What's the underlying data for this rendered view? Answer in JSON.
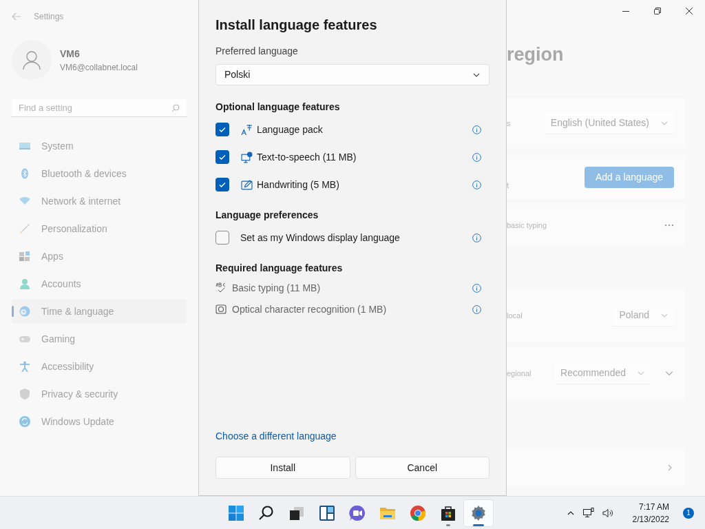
{
  "settings": {
    "title": "Settings",
    "account": {
      "name": "VM6",
      "email": "VM6@collabnet.local"
    },
    "search": {
      "placeholder": "Find a setting"
    },
    "nav": [
      {
        "label": "System",
        "selected": false
      },
      {
        "label": "Bluetooth & devices",
        "selected": false
      },
      {
        "label": "Network & internet",
        "selected": false
      },
      {
        "label": "Personalization",
        "selected": false
      },
      {
        "label": "Apps",
        "selected": false
      },
      {
        "label": "Accounts",
        "selected": false
      },
      {
        "label": "Time & language",
        "selected": true
      },
      {
        "label": "Gaming",
        "selected": false
      },
      {
        "label": "Accessibility",
        "selected": false
      },
      {
        "label": "Privacy & security",
        "selected": false
      },
      {
        "label": "Windows Update",
        "selected": false
      }
    ],
    "page_title": "region",
    "cards": [
      {
        "kind": "dropdown",
        "label": "s",
        "value": "English (United States)"
      },
      {
        "kind": "button",
        "label": "t",
        "button": "Add a language"
      },
      {
        "kind": "more",
        "label": "basic typing"
      },
      {
        "kind": "dropdown",
        "label": "local",
        "value": "Poland"
      },
      {
        "kind": "dropdown_expand",
        "label": "egional",
        "value": "Recommended"
      },
      {
        "kind": "link"
      }
    ]
  },
  "dialog": {
    "title": "Install language features",
    "preferred_label": "Preferred language",
    "preferred_value": "Polski",
    "optional_heading": "Optional language features",
    "optional_features": [
      {
        "label": "Language pack",
        "checked": true
      },
      {
        "label": "Text-to-speech (11 MB)",
        "checked": true
      },
      {
        "label": "Handwriting (5 MB)",
        "checked": true
      }
    ],
    "preferences_heading": "Language preferences",
    "preferences": [
      {
        "label": "Set as my Windows display language",
        "checked": false
      }
    ],
    "required_heading": "Required language features",
    "required_features": [
      {
        "label": "Basic typing (11 MB)"
      },
      {
        "label": "Optical character recognition (1 MB)"
      }
    ],
    "link": "Choose a different language",
    "buttons": [
      "Install",
      "Cancel"
    ]
  },
  "taskbar": {
    "apps": [
      {
        "selected": false,
        "running": false
      },
      {
        "selected": false,
        "running": false
      },
      {
        "selected": false,
        "running": false
      },
      {
        "selected": false,
        "running": false
      },
      {
        "selected": false,
        "running": false
      },
      {
        "selected": false,
        "running": false
      },
      {
        "selected": false,
        "running": false
      },
      {
        "selected": false,
        "running": true
      },
      {
        "selected": true,
        "running": true
      }
    ],
    "time": "7:17 AM",
    "date": "2/13/2022",
    "notifications": "1"
  }
}
